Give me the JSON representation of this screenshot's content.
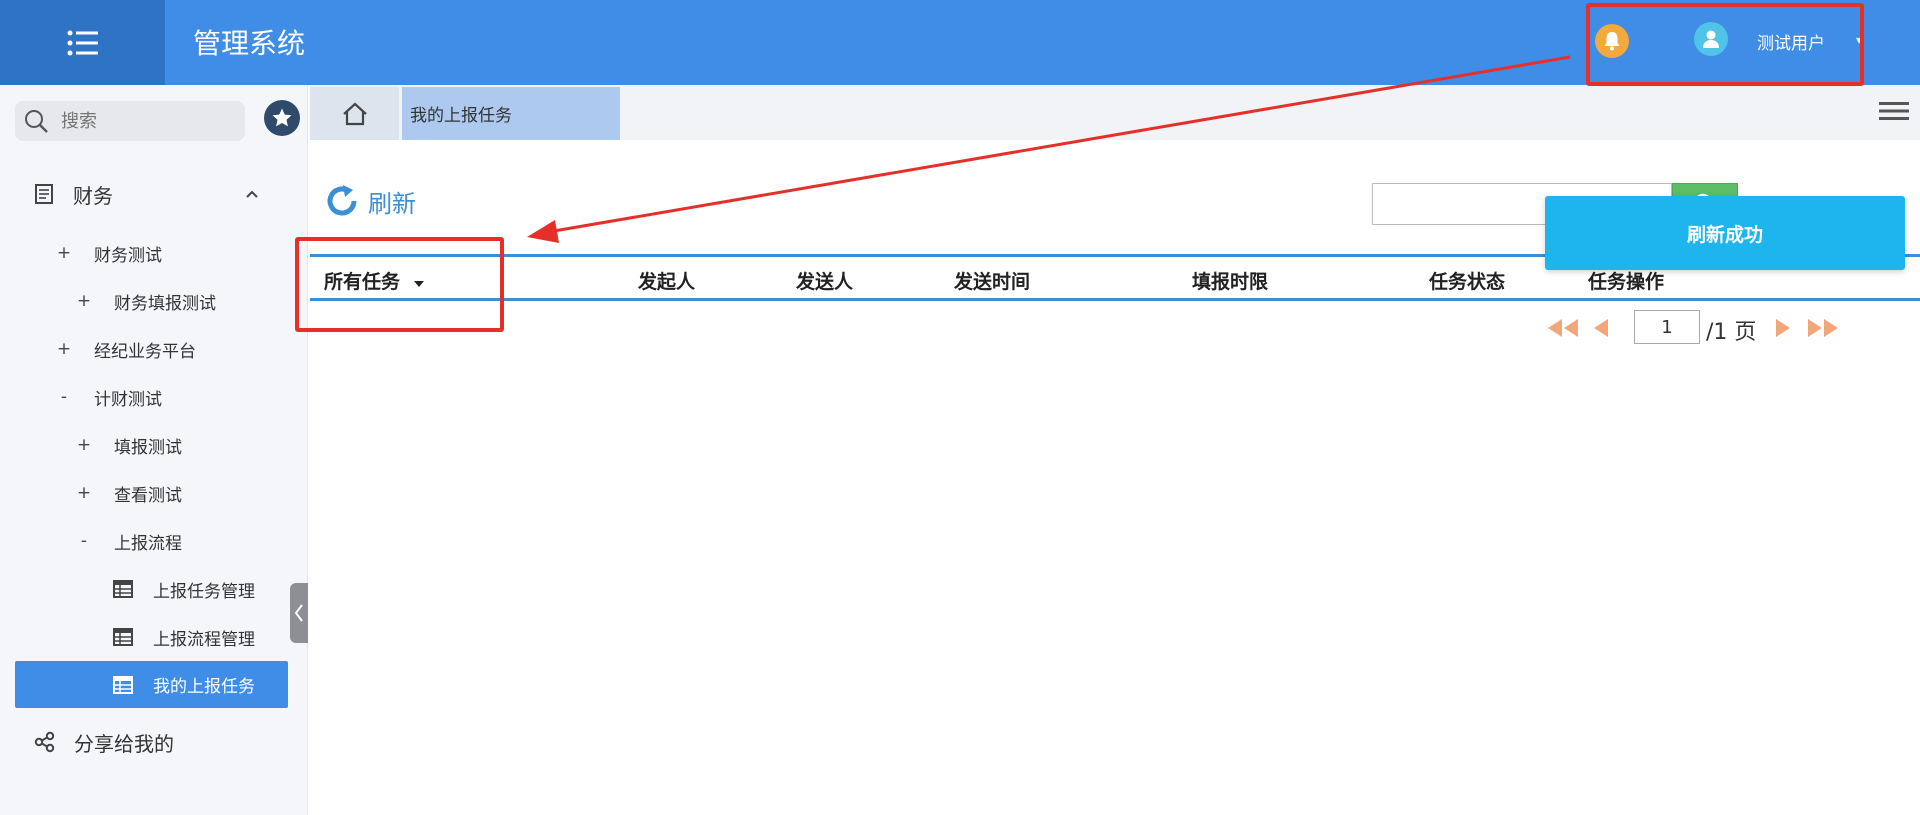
{
  "header": {
    "app_title": "管理系统",
    "username": "测试用户",
    "color_primary": "#3f8de6",
    "color_menu_bg": "#2f74c4"
  },
  "sidebar": {
    "search_placeholder": "搜索",
    "items": [
      {
        "label": "财务",
        "sign": "^"
      },
      {
        "label": "财务测试",
        "sign": "+"
      },
      {
        "label": "财务填报测试",
        "sign": "+"
      },
      {
        "label": "经纪业务平台",
        "sign": "+"
      },
      {
        "label": "计财测试",
        "sign": "-"
      },
      {
        "label": "填报测试",
        "sign": "+"
      },
      {
        "label": "查看测试",
        "sign": "+"
      },
      {
        "label": "上报流程",
        "sign": "-"
      },
      {
        "label": "上报任务管理",
        "icon": "table-icon"
      },
      {
        "label": "上报流程管理",
        "icon": "table-icon"
      },
      {
        "label": "我的上报任务",
        "icon": "table-icon",
        "active": true
      },
      {
        "label": "分享给我的",
        "icon": "share-icon"
      }
    ]
  },
  "tabs": {
    "home_icon": "home-icon",
    "items": [
      {
        "label": "我的上报任务"
      }
    ]
  },
  "toolbar": {
    "refresh_label": "刷新",
    "search_value": ""
  },
  "table": {
    "columns": [
      "所有任务",
      "发起人",
      "发送人",
      "发送时间",
      "填报时限",
      "任务状态",
      "任务操作"
    ],
    "rows": []
  },
  "pager": {
    "current_page": "1",
    "total_text": "/1 页"
  },
  "toast": {
    "message": "刷新成功",
    "color": "#1eb5ee"
  },
  "annotation": {
    "color": "#e5302a"
  }
}
